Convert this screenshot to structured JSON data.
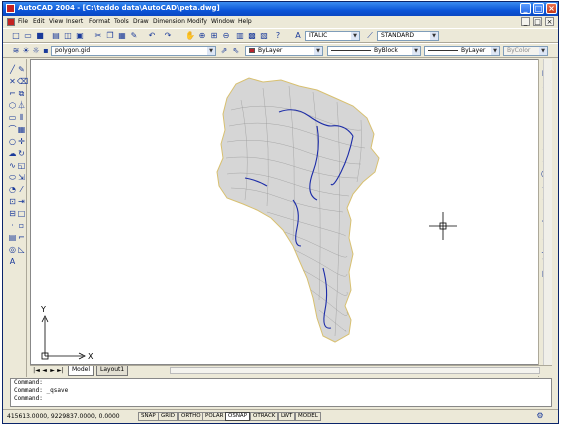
{
  "window": {
    "title": "AutoCAD 2004 - [C:\\teddo data\\AutoCAD\\peta.dwg]",
    "controls": {
      "minimize": "_",
      "maximize": "□",
      "close": "×"
    }
  },
  "menubar": {
    "items": [
      "File",
      "Edit",
      "View",
      "Insert",
      "Format",
      "Tools",
      "Draw",
      "Dimension",
      "Modify",
      "Window",
      "Help"
    ],
    "doc_controls": [
      "_",
      "□",
      "×"
    ]
  },
  "standard_toolbar": {
    "icons": [
      "new-icon",
      "open-icon",
      "save-icon",
      "print-icon",
      "preview-icon",
      "plot-icon",
      "cut-icon",
      "copy-icon",
      "paste-icon",
      "match-icon",
      "undo-icon",
      "redo-icon",
      "pan-icon",
      "zoom-realtime-icon",
      "zoom-window-icon",
      "zoom-previous-icon",
      "properties-icon",
      "design-center-icon",
      "tool-palettes-icon",
      "help-icon"
    ],
    "text_style": "ITALIC",
    "dim_style": "STANDARD"
  },
  "layers_toolbar": {
    "layer": "polygon.gid",
    "color": "ByLayer",
    "color_swatch": "#b8232d",
    "linetype": "ByBlock",
    "lineweight": "ByLayer",
    "plotstyle": "ByColor"
  },
  "drawing": {
    "ucs_x": "X",
    "ucs_y": "Y",
    "map_fill": "#d6d6d6",
    "map_outline": "#d8c070",
    "river_color": "#1c2ca8"
  },
  "tabs": {
    "nav": [
      "|◄",
      "◄",
      "►",
      "►|"
    ],
    "items": [
      "Model",
      "Layout1"
    ]
  },
  "command": {
    "lines": [
      "Command:",
      "Command: _qsave",
      "Command:"
    ]
  },
  "status": {
    "coordinates": "415613.0000, 9229837.0000, 0.0000",
    "buttons": [
      "SNAP",
      "GRID",
      "ORTHO",
      "POLAR",
      "OSNAP",
      "OTRACK",
      "LWT",
      "MODEL"
    ]
  }
}
